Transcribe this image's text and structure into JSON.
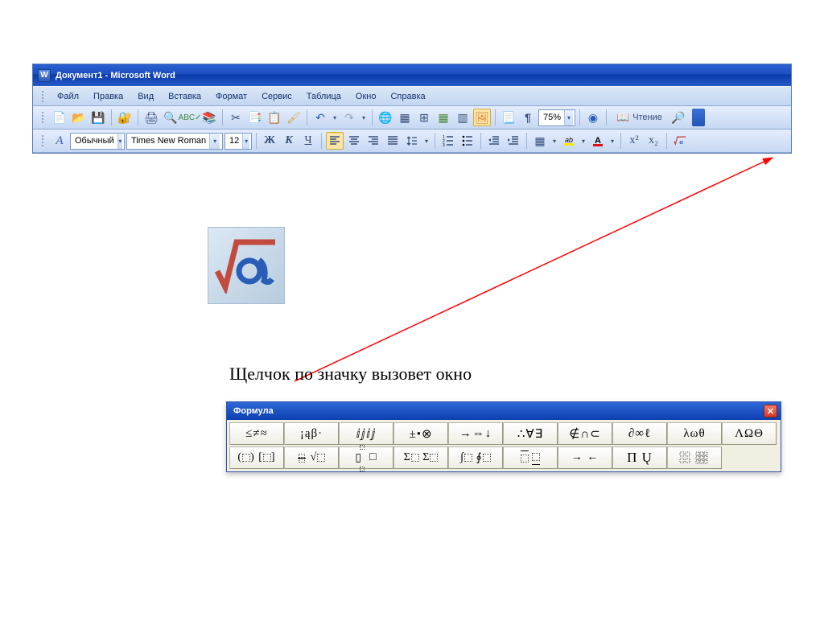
{
  "word": {
    "title": "Документ1 - Microsoft Word",
    "menus": [
      "Файл",
      "Правка",
      "Вид",
      "Вставка",
      "Формат",
      "Сервис",
      "Таблица",
      "Окно",
      "Справка"
    ],
    "zoom": "75%",
    "read_label": "Чтение",
    "style": "Обычный",
    "font": "Times New Roman",
    "size": "12",
    "bold": "Ж",
    "italic": "К",
    "underline": "Ч",
    "super": "x²",
    "sub": "x₂",
    "formula": "√α"
  },
  "caption": "Щелчок по значку вызовет окно",
  "formula_window": {
    "title": "Формула",
    "row1": [
      "≤≠≈",
      "¡ąβ·",
      "ⅈⅉⅈⅉ",
      "±•⊗",
      "→⇔↓",
      "∴∀∃",
      "∉∩⊂",
      "∂∞ℓ",
      "λωθ",
      "ΛΩΘ"
    ],
    "row2": [
      "(⸬) [⸬]",
      "⸬⁄⸬ √⸬",
      "⸬: □",
      "Σ⸬ Σ⸬",
      "∫⸬ ∮⸬",
      "⸬ ⸬",
      "→ ←",
      "Π Ų",
      "▯▯▯"
    ]
  }
}
